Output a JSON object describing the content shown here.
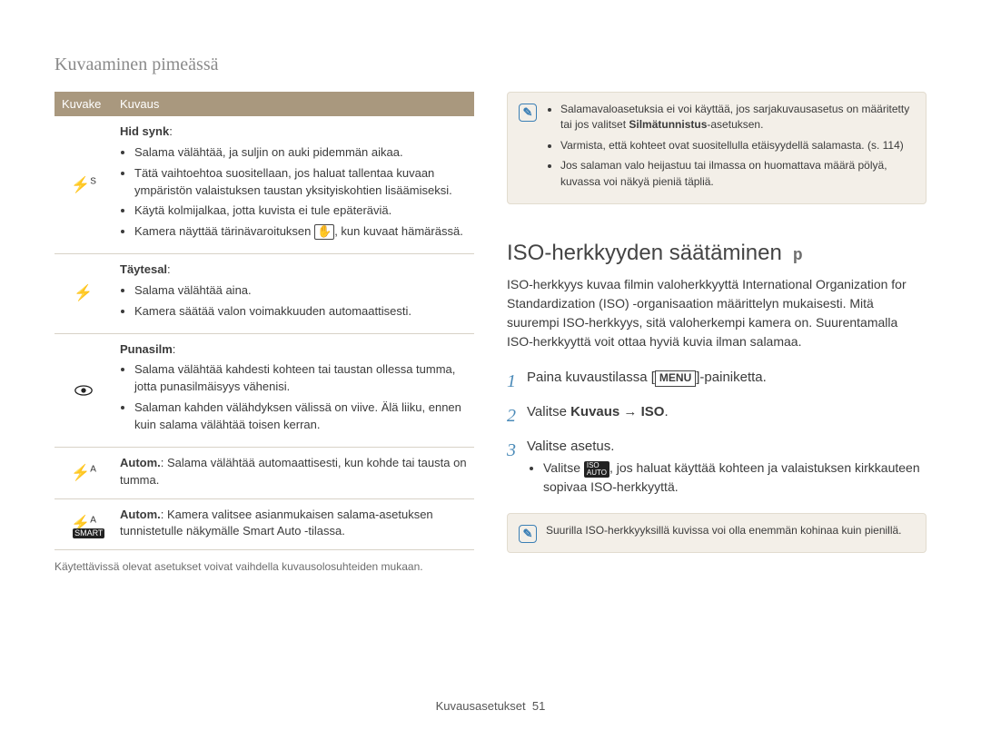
{
  "page_title": "Kuvaaminen pimeässä",
  "table_header": {
    "icon": "Kuvake",
    "desc": "Kuvaus"
  },
  "rows": [
    {
      "icon_name": "slow-sync-flash-icon",
      "label": "Hid synk",
      "items": [
        "Salama välähtää, ja suljin on auki pidemmän aikaa.",
        "Tätä vaihtoehtoa suositellaan, jos haluat tallentaa kuvaan ympäristön valaistuksen taustan yksityiskohtien lisäämiseksi.",
        "Käytä kolmijalkaa, jotta kuvista ei tule epäteräviä.",
        "Kamera näyttää tärinävaroituksen ⟨hand⟩, kun kuvaat hämärässä."
      ]
    },
    {
      "icon_name": "fill-flash-icon",
      "label": "Täytesal",
      "items": [
        "Salama välähtää aina.",
        "Kamera säätää valon voimakkuuden automaattisesti."
      ]
    },
    {
      "icon_name": "red-eye-icon",
      "label": "Punasilm",
      "items": [
        "Salama välähtää kahdesti kohteen tai taustan ollessa tumma, jotta punasilmäisyys vähenisi.",
        "Salaman kahden välähdyksen välissä on viive. Älä liiku, ennen kuin salama välähtää toisen kerran."
      ]
    },
    {
      "icon_name": "auto-flash-icon",
      "plain": "Autom.: Salama välähtää automaattisesti, kun kohde tai tausta on tumma.",
      "plain_label": "Autom."
    },
    {
      "icon_name": "smart-auto-flash-icon",
      "plain": "Autom.: Kamera valitsee asianmukaisen salama-asetuksen tunnistetulle näkymälle Smart Auto -tilassa.",
      "plain_label": "Autom."
    }
  ],
  "table_footnote": "Käytettävissä olevat asetukset voivat vaihdella kuvausolosuhteiden mukaan.",
  "note1": {
    "items": [
      {
        "pre": "Salamavaloasetuksia ei voi käyttää, jos sarjakuvausasetus on määritetty tai jos valitset ",
        "bold": "Silmätunnistus",
        "post": "-asetuksen."
      },
      {
        "pre": "Varmista, että kohteet ovat suositellulla etäisyydellä salamasta. (s. 114)"
      },
      {
        "pre": "Jos salaman valo heijastuu tai ilmassa on huomattava määrä pölyä, kuvassa voi näkyä pieniä täpliä."
      }
    ]
  },
  "section_title": "ISO-herkkyyden säätäminen",
  "mode_badge": "p",
  "section_desc": "ISO-herkkyys kuvaa filmin valoherkkyyttä International Organization for Standardization (ISO) -organisaation määrittelyn mukaisesti. Mitä suurempi ISO-herkkyys, sitä valoherkempi kamera on. Suurentamalla ISO-herkkyyttä voit ottaa hyviä kuvia ilman salamaa.",
  "steps": [
    {
      "n": "1",
      "pre": "Paina kuvaustilassa [",
      "menu": "MENU",
      "post": "]-painiketta."
    },
    {
      "n": "2",
      "pre": "Valitse ",
      "bold": "Kuvaus → ISO",
      "post": "."
    },
    {
      "n": "3",
      "pre": "Valitse asetus.",
      "sub": {
        "pre": "Valitse ",
        "icon": "iso-auto-icon",
        "post": ", jos haluat käyttää kohteen ja valaistuksen kirkkauteen sopivaa ISO-herkkyyttä."
      }
    }
  ],
  "note2": "Suurilla ISO-herkkyyksillä kuvissa voi olla enemmän kohinaa kuin pienillä.",
  "footer": {
    "label": "Kuvausasetukset",
    "page": "51"
  }
}
